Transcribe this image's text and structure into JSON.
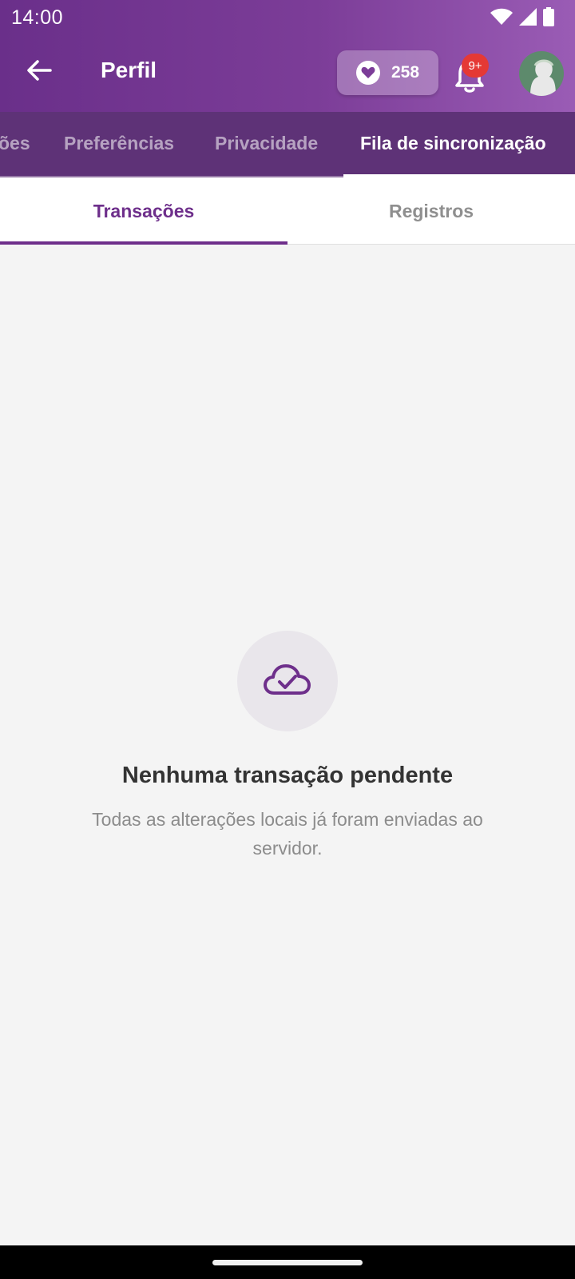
{
  "status_bar": {
    "time": "14:00",
    "icons": [
      "wifi-icon",
      "signal-icon",
      "battery-icon"
    ]
  },
  "app_bar": {
    "title": "Perfil",
    "points": "258",
    "notification_badge": "9+"
  },
  "main_tabs": {
    "items": [
      {
        "label": "ões"
      },
      {
        "label": "Preferências"
      },
      {
        "label": "Privacidade"
      },
      {
        "label": "Fila de sincronização",
        "active": true
      }
    ]
  },
  "sub_tabs": {
    "items": [
      {
        "label": "Transações",
        "active": true
      },
      {
        "label": "Registros"
      }
    ]
  },
  "empty_state": {
    "icon": "cloud-check-icon",
    "title": "Nenhuma transação pendente",
    "subtitle": "Todas as alterações locais já foram enviadas ao servidor."
  },
  "colors": {
    "primary": "#6e2f8b",
    "header_gradient_start": "#6a2f8a",
    "header_gradient_end": "#9a5cb5",
    "tab_bar": "#5e3277",
    "badge": "#e53935"
  }
}
